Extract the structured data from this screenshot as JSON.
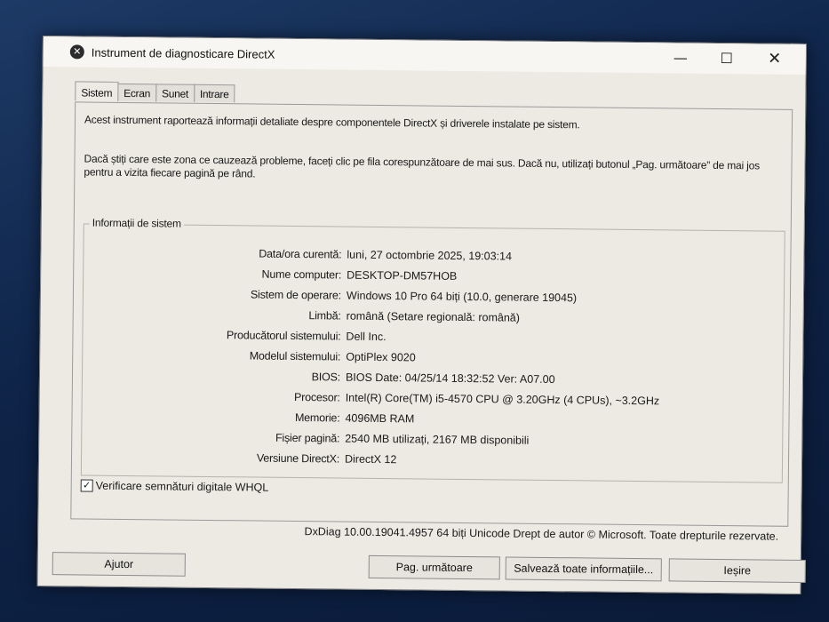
{
  "window": {
    "title": "Instrument de diagnosticare DirectX",
    "icon": "directx-icon",
    "controls": {
      "minimize": "—",
      "maximize": "☐",
      "close": "✕"
    }
  },
  "tabs": [
    {
      "label": "Sistem",
      "active": true
    },
    {
      "label": "Ecran",
      "active": false
    },
    {
      "label": "Sunet",
      "active": false
    },
    {
      "label": "Intrare",
      "active": false
    }
  ],
  "intro": {
    "line1": "Acest instrument raportează informații detaliate despre componentele DirectX și driverele instalate pe sistem.",
    "line2": "Dacă știți care este zona ce cauzează probleme, faceți clic pe fila corespunzătoare de mai sus. Dacă nu, utilizați butonul „Pag. următoare” de mai jos pentru a vizita fiecare pagină pe rând."
  },
  "system_info": {
    "title": "Informații de sistem",
    "rows": [
      {
        "label": "Data/ora curentă:",
        "value": "luni, 27 octombrie 2025, 19:03:14"
      },
      {
        "label": "Nume computer:",
        "value": "DESKTOP-DM57HOB"
      },
      {
        "label": "Sistem de operare:",
        "value": "Windows 10 Pro 64 biți (10.0, generare 19045)"
      },
      {
        "label": "Limbă:",
        "value": "română (Setare regională: română)"
      },
      {
        "label": "Producătorul sistemului:",
        "value": "Dell Inc."
      },
      {
        "label": "Modelul sistemului:",
        "value": "OptiPlex 9020"
      },
      {
        "label": "BIOS:",
        "value": "BIOS Date: 04/25/14 18:32:52 Ver: A07.00"
      },
      {
        "label": "Procesor:",
        "value": "Intel(R) Core(TM) i5-4570 CPU @ 3.20GHz (4 CPUs), ~3.2GHz"
      },
      {
        "label": "Memorie:",
        "value": "4096MB RAM"
      },
      {
        "label": "Fișier pagină:",
        "value": "2540 MB utilizați, 2167 MB disponibili"
      },
      {
        "label": "Versiune DirectX:",
        "value": "DirectX 12"
      }
    ]
  },
  "whql_checkbox": {
    "label": "Verificare semnături digitale WHQL",
    "checked": true
  },
  "footer": "DxDiag 10.00.19041.4957 64 biți Unicode  Drept de autor © Microsoft. Toate drepturile rezervate.",
  "buttons": {
    "help": "Ajutor",
    "next": "Pag. următoare",
    "save": "Salvează toate informațiile...",
    "exit": "Ieșire"
  }
}
